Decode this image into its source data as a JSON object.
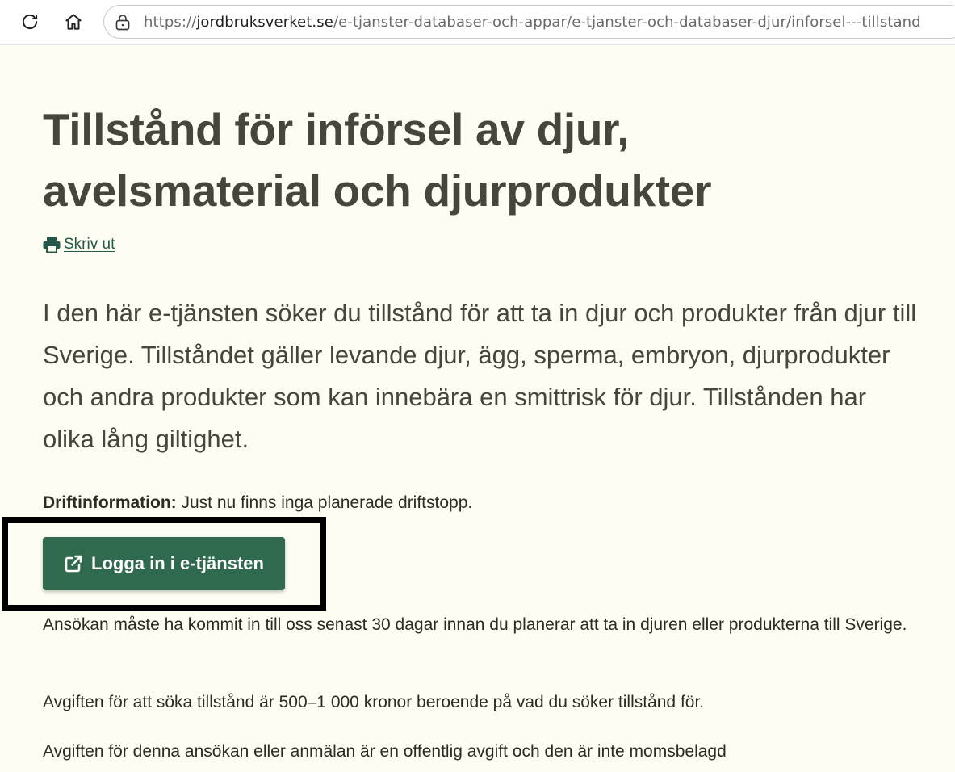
{
  "browser": {
    "url_prefix": "https://",
    "url_domain": "jordbruksverket.se",
    "url_path": "/e-tjanster-databaser-och-appar/e-tjanster-och-databaser-djur/inforsel---tillstand"
  },
  "page": {
    "title": "Tillstånd för införsel av djur, avelsmaterial och djurprodukter",
    "print_label": "Skriv ut",
    "lead": "I den här e-tjänsten söker du tillstånd för att ta in djur och produkter från djur till Sverige. Tillståndet gäller levande djur, ägg, sperma, embryon, djurprodukter och andra produkter som kan innebära en smittrisk för djur. Tillstånden har olika lång giltighet.",
    "drift_label": "Driftinformation:",
    "drift_text": " Just nu finns inga planerade driftstopp.",
    "login_button": "Logga in i e-tjänsten",
    "paragraphs": [
      "Ansökan måste ha kommit in till oss senast 30 dagar innan du planerar att ta in djuren eller produkterna till Sverige.",
      "Avgiften för att söka tillstånd är 500–1 000 kronor beroende på vad du söker tillstånd för.",
      "Avgiften för denna ansökan eller anmälan är en offentlig avgift och den är inte momsbelagd"
    ]
  },
  "colors": {
    "page_background": "#fefdf1",
    "brand_green": "#2f6a4f",
    "link_green": "#23594a",
    "heading": "#48453a"
  },
  "icons": {
    "reload": "reload-icon",
    "home": "home-icon",
    "lock": "lock-icon",
    "print": "printer-icon",
    "external": "external-link-icon"
  }
}
